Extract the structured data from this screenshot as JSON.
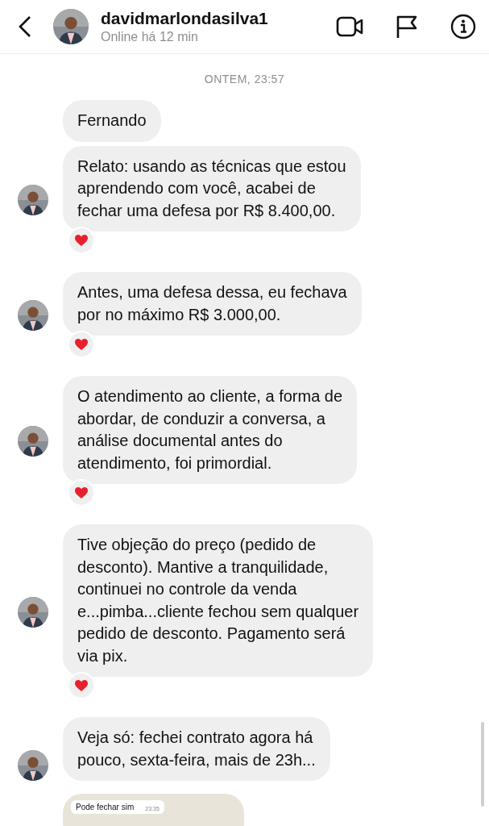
{
  "header": {
    "name": "davidmarlondasilva1",
    "status": "Online há 12 min"
  },
  "date_divider": "ONTEM, 23:57",
  "messages": [
    {
      "kind": "text",
      "lines": [
        "Fernando"
      ],
      "avatar": false,
      "reaction": false
    },
    {
      "kind": "text",
      "lines": [
        "Relato: usando as técnicas que estou",
        "aprendendo com você, acabei de",
        "fechar uma defesa por R$ 8.400,00."
      ],
      "avatar": true,
      "reaction": true
    },
    {
      "kind": "text",
      "lines": [
        "Antes, uma defesa dessa, eu fechava",
        "por no máximo R$ 3.000,00."
      ],
      "avatar": true,
      "reaction": true
    },
    {
      "kind": "text",
      "lines": [
        "O atendimento ao cliente, a forma de",
        "abordar, de conduzir a conversa, a",
        "análise documental antes do",
        "atendimento, foi primordial."
      ],
      "avatar": true,
      "reaction": true
    },
    {
      "kind": "text",
      "lines": [
        "Tive objeção do preço (pedido de",
        "desconto). Mantive a tranquilidade,",
        "continuei no controle da venda",
        "e...pimba...cliente fechou sem qualquer",
        "pedido de desconto. Pagamento será",
        "via pix."
      ],
      "avatar": true,
      "reaction": true
    },
    {
      "kind": "text",
      "lines": [
        "Veja só: fechei contrato agora há",
        "pouco, sexta-feira, mais de 23h..."
      ],
      "avatar": true,
      "reaction": false
    },
    {
      "kind": "screenshot",
      "text": "Pode fechar sim",
      "time": "23:35",
      "avatar": false,
      "reaction": false
    }
  ]
}
